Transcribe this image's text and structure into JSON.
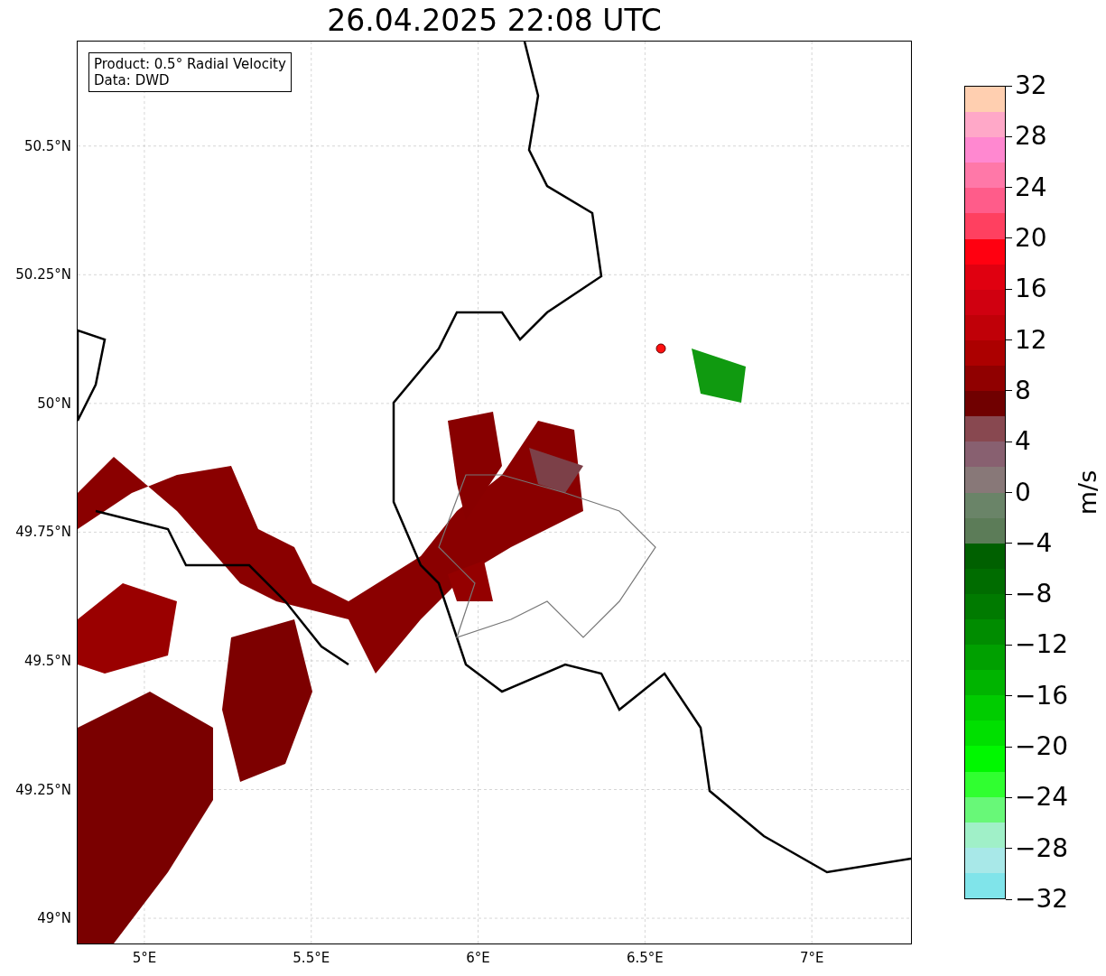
{
  "title": "26.04.2025 22:08 UTC",
  "info_box": [
    "Product: 0.5° Radial Velocity",
    "Data: DWD"
  ],
  "map": {
    "yticks": [
      "50.5°N",
      "50.25°N",
      "50°N",
      "49.75°N",
      "49.5°N",
      "49.25°N",
      "49°N"
    ],
    "xticks": [
      "5°E",
      "5.5°E",
      "6°E",
      "6.5°E",
      "7°E"
    ]
  },
  "colorbar": {
    "label": "m/s",
    "ticks": [
      "32",
      "28",
      "24",
      "20",
      "16",
      "12",
      "8",
      "4",
      "0",
      "−4",
      "−8",
      "−12",
      "−16",
      "−20",
      "−24",
      "−28",
      "−32"
    ]
  }
}
